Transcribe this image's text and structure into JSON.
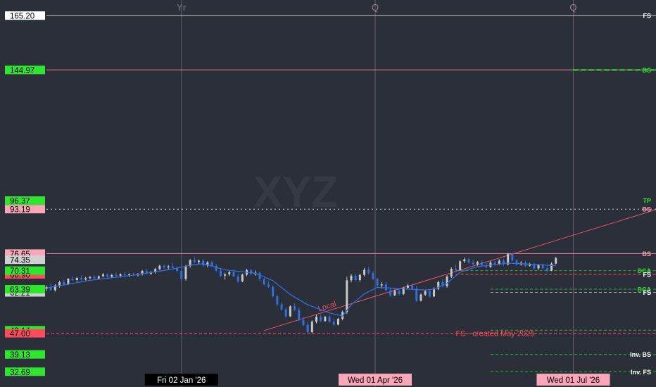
{
  "chart_data": {
    "type": "candlestick",
    "ticker_watermark": "XYZ",
    "y_range": [
      27,
      171
    ],
    "x_range": [
      "2025-11-01",
      "2026-08-08"
    ],
    "period_markers": [
      {
        "label": "Yr",
        "date": "2026-01-02"
      },
      {
        "label": "Q",
        "date": "2026-04-01"
      },
      {
        "label": "Q",
        "date": "2026-07-01"
      }
    ],
    "x_axis_labels": [
      {
        "text": "Fri 02 Jan '26",
        "date": "2026-01-02",
        "style": "dark"
      },
      {
        "text": "Wed 01 Apr '26",
        "date": "2026-04-01",
        "style": "pink"
      },
      {
        "text": "Wed 01 Jul '26",
        "date": "2026-07-01",
        "style": "pink"
      }
    ],
    "price_tags": [
      {
        "value": 165.2,
        "text": "165.20",
        "bg": "#ffffff",
        "fg": "#000000"
      },
      {
        "value": 144.97,
        "text": "144.97",
        "bg": "#2ee62e",
        "fg": "#000000"
      },
      {
        "value": 96.37,
        "text": "96.37",
        "bg": "#2ee62e",
        "fg": "#000000"
      },
      {
        "value": 93.19,
        "text": "93.19",
        "bg": "#f8a6b8",
        "fg": "#000000"
      },
      {
        "value": 76.65,
        "text": "76.65",
        "bg": "#f8a6b8",
        "fg": "#000000"
      },
      {
        "value": 74.35,
        "text": "74.35",
        "bg": "#d0d0d0",
        "fg": "#000000"
      },
      {
        "value": 68.9,
        "text": "68.90",
        "bg": "#ff4c5c",
        "fg": "#000000"
      },
      {
        "value": 70.31,
        "text": "70.31",
        "bg": "#2ee62e",
        "fg": "#000000"
      },
      {
        "value": 62.21,
        "text": "62.21",
        "bg": "#d0d0d0",
        "fg": "#000000"
      },
      {
        "value": 63.39,
        "text": "63.39",
        "bg": "#2ee62e",
        "fg": "#000000"
      },
      {
        "value": 48.14,
        "text": "48.14",
        "bg": "#2ee62e",
        "fg": "#000000"
      },
      {
        "value": 47.0,
        "text": "47.00",
        "bg": "#ff4c5c",
        "fg": "#000000"
      },
      {
        "value": 39.13,
        "text": "39.13",
        "bg": "#2ee62e",
        "fg": "#000000"
      },
      {
        "value": 32.69,
        "text": "32.69",
        "bg": "#2ee62e",
        "fg": "#000000"
      }
    ],
    "levels": [
      {
        "value": 165.2,
        "color": "#c8c8c8",
        "style": "solid",
        "from": "2025-11-01",
        "label": "FS",
        "label_color": "#ffffff"
      },
      {
        "value": 144.97,
        "color": "#e88aa0",
        "style": "solid",
        "from": "2025-11-01",
        "label": "",
        "label_color": "#e88aa0"
      },
      {
        "value": 144.97,
        "color": "#2ee62e",
        "style": "dashed",
        "from": "2026-07-01",
        "label": "BS",
        "label_color": "#2ee62e"
      },
      {
        "value": 96.37,
        "color": "#2ee62e",
        "style": "none",
        "from": "2025-11-01",
        "label": "TP",
        "label_color": "#2ee62e"
      },
      {
        "value": 93.19,
        "color": "#dddddd",
        "style": "dotted",
        "from": "2025-11-01",
        "label": "BS",
        "label_color": "#f8a6b8"
      },
      {
        "value": 76.65,
        "color": "#e88aa0",
        "style": "solid",
        "from": "2025-11-01",
        "label": "BS",
        "label_color": "#f8a6b8"
      },
      {
        "value": 70.31,
        "color": "#2ee62e",
        "style": "dashed",
        "from": "2026-05-08",
        "label": "DCA",
        "label_color": "#2ee62e"
      },
      {
        "value": 68.9,
        "color": "#ff4c5c",
        "style": "dashed",
        "from": "2026-05-08",
        "label": "FS",
        "label_color": "#ffffff"
      },
      {
        "value": 63.39,
        "color": "#2ee62e",
        "style": "dashed",
        "from": "2026-05-24",
        "label": "DCA",
        "label_color": "#2ee62e"
      },
      {
        "value": 62.21,
        "color": "#aaaaaa",
        "style": "dashed",
        "from": "2026-05-24",
        "label": "FS",
        "label_color": "#ffffff"
      },
      {
        "value": 48.14,
        "color": "#2ee62e",
        "style": "dashed",
        "from": "2026-05-24",
        "label": "",
        "label_color": "#2ee62e"
      },
      {
        "value": 47.0,
        "color": "#ff4c5c",
        "style": "dashed",
        "from": "2025-11-01",
        "label": "",
        "label_color": "#ff4c5c"
      },
      {
        "value": 39.13,
        "color": "#2ee62e",
        "style": "dashed",
        "from": "2026-05-24",
        "label": "Inv. BS",
        "label_color": "#ffffff"
      },
      {
        "value": 32.69,
        "color": "#2ee62e",
        "style": "dashed",
        "from": "2026-05-24",
        "label": "Inv. FS",
        "label_color": "#ffffff"
      }
    ],
    "level_annotation": {
      "text": "FS - created May 2025",
      "value": 47.0,
      "date": "2026-05-08",
      "color": "#ff4c5c"
    },
    "trendline": {
      "label": "Local",
      "points": [
        [
          "2026-02-09",
          48
        ],
        [
          "2026-08-08",
          93
        ]
      ],
      "color": "#e8506a"
    },
    "candles": [
      [
        "2025-11-01",
        63.5,
        64.8,
        62.6,
        64.2
      ],
      [
        "2025-11-03",
        64.2,
        65.5,
        63.5,
        63.0
      ],
      [
        "2025-11-05",
        63.0,
        65.3,
        62.5,
        64.8
      ],
      [
        "2025-11-07",
        64.8,
        66.5,
        64.0,
        66.0
      ],
      [
        "2025-11-09",
        66.0,
        67.0,
        64.8,
        65.2
      ],
      [
        "2025-11-11",
        65.2,
        67.5,
        64.9,
        67.3
      ],
      [
        "2025-11-13",
        67.3,
        68.2,
        66.4,
        66.8
      ],
      [
        "2025-11-15",
        66.8,
        68.0,
        66.2,
        67.6
      ],
      [
        "2025-11-17",
        67.6,
        68.5,
        66.5,
        67.0
      ],
      [
        "2025-11-19",
        67.0,
        68.0,
        66.6,
        67.5
      ],
      [
        "2025-11-21",
        67.5,
        68.3,
        67.1,
        67.9
      ],
      [
        "2025-11-23",
        67.9,
        68.6,
        67.2,
        67.4
      ],
      [
        "2025-11-25",
        67.4,
        68.5,
        67.1,
        68.2
      ],
      [
        "2025-11-27",
        68.2,
        69.4,
        67.8,
        68.9
      ],
      [
        "2025-11-29",
        68.9,
        69.2,
        67.6,
        68.0
      ],
      [
        "2025-12-01",
        68.0,
        69.0,
        67.6,
        68.7
      ],
      [
        "2025-12-03",
        68.7,
        69.6,
        68.0,
        68.4
      ],
      [
        "2025-12-05",
        68.4,
        69.3,
        67.7,
        69.0
      ],
      [
        "2025-12-07",
        69.0,
        69.7,
        68.2,
        68.6
      ],
      [
        "2025-12-09",
        68.6,
        69.3,
        67.9,
        68.9
      ],
      [
        "2025-12-11",
        68.9,
        69.6,
        68.3,
        68.6
      ],
      [
        "2025-12-13",
        68.6,
        69.4,
        68.1,
        69.0
      ],
      [
        "2025-12-15",
        69.0,
        70.6,
        68.5,
        70.2
      ],
      [
        "2025-12-17",
        70.2,
        71.0,
        68.8,
        69.2
      ],
      [
        "2025-12-19",
        69.2,
        70.1,
        68.6,
        69.8
      ],
      [
        "2025-12-21",
        69.8,
        71.3,
        69.2,
        70.9
      ],
      [
        "2025-12-23",
        70.9,
        72.5,
        70.5,
        72.1
      ],
      [
        "2025-12-25",
        72.1,
        72.6,
        71.0,
        71.5
      ],
      [
        "2025-12-27",
        71.5,
        72.4,
        70.6,
        71.9
      ],
      [
        "2025-12-29",
        71.9,
        73.3,
        71.4,
        71.3
      ],
      [
        "2025-12-31",
        71.3,
        71.8,
        69.8,
        70.2
      ],
      [
        "2026-01-02",
        70.2,
        71.0,
        66.5,
        67.2
      ],
      [
        "2026-01-04",
        67.2,
        72.4,
        66.6,
        72.0
      ],
      [
        "2026-01-06",
        72.0,
        74.6,
        71.4,
        74.2
      ],
      [
        "2026-01-08",
        74.2,
        75.3,
        73.0,
        73.5
      ],
      [
        "2026-01-10",
        73.5,
        74.5,
        72.5,
        74.0
      ],
      [
        "2026-01-12",
        74.0,
        74.6,
        71.8,
        72.2
      ],
      [
        "2026-01-14",
        72.2,
        73.8,
        71.5,
        73.4
      ],
      [
        "2026-01-16",
        73.4,
        74.0,
        71.8,
        72.0
      ],
      [
        "2026-01-18",
        72.0,
        72.8,
        69.9,
        70.3
      ],
      [
        "2026-01-20",
        70.3,
        71.0,
        67.9,
        68.4
      ],
      [
        "2026-01-22",
        68.4,
        69.5,
        67.0,
        68.9
      ],
      [
        "2026-01-24",
        68.9,
        70.2,
        68.3,
        69.7
      ],
      [
        "2026-01-26",
        69.7,
        70.6,
        67.8,
        68.2
      ],
      [
        "2026-01-28",
        68.2,
        69.1,
        65.8,
        66.3
      ],
      [
        "2026-01-30",
        66.3,
        69.2,
        66.0,
        68.8
      ],
      [
        "2026-02-01",
        68.8,
        71.0,
        68.2,
        70.5
      ],
      [
        "2026-02-03",
        70.5,
        71.0,
        68.6,
        69.0
      ],
      [
        "2026-02-05",
        69.0,
        70.4,
        68.4,
        69.5
      ],
      [
        "2026-02-07",
        69.5,
        69.8,
        66.6,
        67.1
      ],
      [
        "2026-02-09",
        67.1,
        67.6,
        64.8,
        65.2
      ],
      [
        "2026-02-11",
        65.2,
        66.4,
        63.9,
        64.3
      ],
      [
        "2026-02-13",
        64.3,
        64.8,
        60.3,
        60.8
      ],
      [
        "2026-02-15",
        60.8,
        61.2,
        57.2,
        57.7
      ],
      [
        "2026-02-17",
        57.7,
        58.5,
        55.4,
        55.9
      ],
      [
        "2026-02-19",
        55.9,
        56.6,
        52.8,
        53.3
      ],
      [
        "2026-02-21",
        53.3,
        57.4,
        53.0,
        57.0
      ],
      [
        "2026-02-23",
        57.0,
        58.2,
        55.2,
        55.7
      ],
      [
        "2026-02-25",
        55.7,
        56.6,
        51.5,
        51.9
      ],
      [
        "2026-02-27",
        51.9,
        53.1,
        49.6,
        50.1
      ],
      [
        "2026-03-01",
        50.1,
        51.2,
        46.7,
        47.4
      ],
      [
        "2026-03-03",
        47.4,
        51.8,
        47.0,
        51.3
      ],
      [
        "2026-03-05",
        51.3,
        53.8,
        50.7,
        53.2
      ],
      [
        "2026-03-07",
        53.2,
        54.0,
        51.1,
        51.6
      ],
      [
        "2026-03-09",
        51.6,
        53.5,
        51.2,
        53.1
      ],
      [
        "2026-03-11",
        53.1,
        53.9,
        50.8,
        51.3
      ],
      [
        "2026-03-13",
        51.3,
        52.3,
        49.8,
        50.2
      ],
      [
        "2026-03-15",
        50.2,
        52.8,
        49.9,
        52.4
      ],
      [
        "2026-03-17",
        52.4,
        55.4,
        51.8,
        54.9
      ],
      [
        "2026-03-19",
        54.9,
        68.0,
        54.2,
        66.7
      ],
      [
        "2026-03-21",
        66.7,
        69.1,
        65.9,
        68.4
      ],
      [
        "2026-03-23",
        68.4,
        69.0,
        66.2,
        66.8
      ],
      [
        "2026-03-25",
        66.8,
        69.2,
        66.1,
        68.7
      ],
      [
        "2026-03-27",
        68.7,
        71.3,
        68.1,
        70.6
      ],
      [
        "2026-03-29",
        70.6,
        71.6,
        68.9,
        69.4
      ],
      [
        "2026-03-31",
        69.4,
        70.2,
        66.7,
        67.2
      ],
      [
        "2026-04-02",
        67.2,
        67.7,
        64.3,
        64.8
      ],
      [
        "2026-04-04",
        64.8,
        66.0,
        63.6,
        65.2
      ],
      [
        "2026-04-06",
        65.2,
        66.0,
        62.5,
        63.0
      ],
      [
        "2026-04-08",
        63.0,
        63.6,
        60.6,
        61.1
      ],
      [
        "2026-04-10",
        61.1,
        63.3,
        60.8,
        62.8
      ],
      [
        "2026-04-12",
        62.8,
        63.4,
        61.0,
        61.6
      ],
      [
        "2026-04-14",
        61.6,
        64.3,
        61.2,
        63.9
      ],
      [
        "2026-04-16",
        63.9,
        65.4,
        63.4,
        64.8
      ],
      [
        "2026-04-18",
        64.8,
        65.5,
        63.1,
        63.6
      ],
      [
        "2026-04-20",
        63.6,
        64.5,
        58.6,
        59.1
      ],
      [
        "2026-04-22",
        59.1,
        61.9,
        58.8,
        61.4
      ],
      [
        "2026-04-24",
        61.4,
        63.2,
        60.8,
        62.7
      ],
      [
        "2026-04-26",
        62.7,
        63.3,
        60.2,
        60.7
      ],
      [
        "2026-04-28",
        60.7,
        64.1,
        60.4,
        63.6
      ],
      [
        "2026-04-30",
        63.6,
        66.5,
        63.1,
        66.1
      ],
      [
        "2026-05-02",
        66.1,
        67.0,
        64.0,
        64.5
      ],
      [
        "2026-05-04",
        64.5,
        68.6,
        64.0,
        68.1
      ],
      [
        "2026-05-06",
        68.1,
        71.5,
        67.6,
        71.0
      ],
      [
        "2026-05-08",
        71.0,
        72.6,
        70.1,
        70.5
      ],
      [
        "2026-05-10",
        70.5,
        74.2,
        70.2,
        73.8
      ],
      [
        "2026-05-12",
        73.8,
        75.2,
        73.1,
        74.5
      ],
      [
        "2026-05-14",
        74.5,
        75.1,
        72.9,
        73.3
      ],
      [
        "2026-05-16",
        73.3,
        74.4,
        72.2,
        72.7
      ],
      [
        "2026-05-18",
        72.7,
        73.9,
        72.1,
        73.5
      ],
      [
        "2026-05-20",
        73.5,
        74.2,
        71.9,
        72.3
      ],
      [
        "2026-05-22",
        72.3,
        73.1,
        71.2,
        71.7
      ],
      [
        "2026-05-24",
        71.7,
        73.9,
        71.3,
        73.3
      ],
      [
        "2026-05-26",
        73.3,
        74.0,
        72.2,
        72.8
      ],
      [
        "2026-05-28",
        72.8,
        74.6,
        72.4,
        74.0
      ],
      [
        "2026-05-30",
        74.0,
        74.8,
        72.1,
        72.6
      ],
      [
        "2026-06-01",
        72.6,
        76.9,
        72.2,
        76.5
      ],
      [
        "2026-06-03",
        76.5,
        76.7,
        73.7,
        74.1
      ],
      [
        "2026-06-05",
        74.1,
        74.6,
        72.2,
        72.6
      ],
      [
        "2026-06-07",
        72.6,
        73.8,
        72.1,
        73.2
      ],
      [
        "2026-06-09",
        73.2,
        74.0,
        71.6,
        72.1
      ],
      [
        "2026-06-11",
        72.1,
        73.2,
        71.8,
        72.7
      ],
      [
        "2026-06-13",
        72.7,
        73.2,
        70.6,
        71.1
      ],
      [
        "2026-06-15",
        71.1,
        72.8,
        70.5,
        72.3
      ],
      [
        "2026-06-17",
        72.3,
        72.9,
        70.8,
        71.2
      ],
      [
        "2026-06-19",
        71.2,
        72.0,
        69.8,
        70.3
      ],
      [
        "2026-06-21",
        70.3,
        73.4,
        70.1,
        72.9
      ],
      [
        "2026-06-23",
        72.9,
        75.4,
        72.6,
        75.0
      ]
    ],
    "moving_average": {
      "name": "",
      "color": "#2f6fe0",
      "values": [
        [
          "2025-11-01",
          63.8
        ],
        [
          "2025-11-21",
          66.7
        ],
        [
          "2025-12-11",
          68.6
        ],
        [
          "2025-12-29",
          70.9
        ],
        [
          "2026-01-06",
          72.3
        ],
        [
          "2026-01-12",
          72.9
        ],
        [
          "2026-01-22",
          70.6
        ],
        [
          "2026-02-05",
          69.3
        ],
        [
          "2026-02-13",
          66.6
        ],
        [
          "2026-02-21",
          61.4
        ],
        [
          "2026-03-01",
          57.6
        ],
        [
          "2026-03-11",
          54.6
        ],
        [
          "2026-03-17",
          53.4
        ],
        [
          "2026-03-21",
          57.6
        ],
        [
          "2026-03-27",
          61.7
        ],
        [
          "2026-04-02",
          64.1
        ],
        [
          "2026-04-12",
          63.6
        ],
        [
          "2026-04-24",
          63.1
        ],
        [
          "2026-04-28",
          63.4
        ],
        [
          "2026-05-04",
          65.6
        ],
        [
          "2026-05-10",
          69.7
        ],
        [
          "2026-05-18",
          71.8
        ],
        [
          "2026-06-01",
          73.1
        ],
        [
          "2026-06-13",
          72.6
        ],
        [
          "2026-06-23",
          72.1
        ]
      ]
    }
  }
}
